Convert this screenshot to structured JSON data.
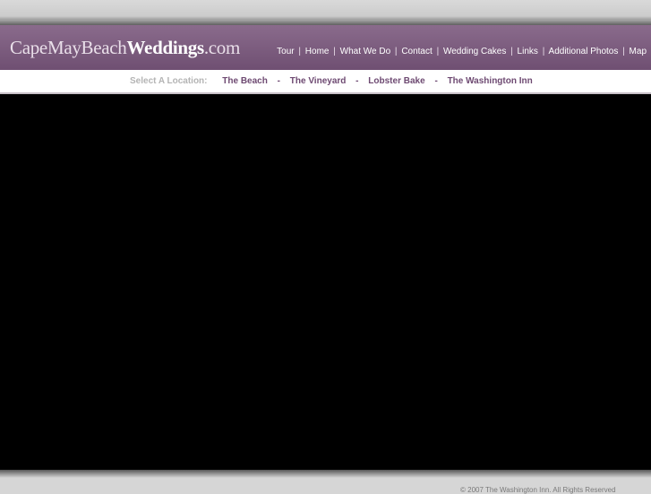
{
  "header": {
    "logo": {
      "part1": "CapeMayBeach",
      "part2": "Weddings",
      "part3": ".com"
    },
    "nav": [
      "Tour",
      "Home",
      "What We Do",
      "Contact",
      "Wedding Cakes",
      "Links",
      "Additional Photos",
      "Map"
    ],
    "nav_separator": "|"
  },
  "locations": {
    "label": "Select A Location:",
    "separator": "-",
    "items": [
      "The Beach",
      "The Vineyard",
      "Lobster Bake",
      "The Washington Inn"
    ]
  },
  "footer": {
    "text": "© 2007 The Washington Inn. All Rights Reserved"
  },
  "colors": {
    "header_purple": "#7a5a7d",
    "location_link": "#6e4a72",
    "stage_black": "#000000"
  }
}
